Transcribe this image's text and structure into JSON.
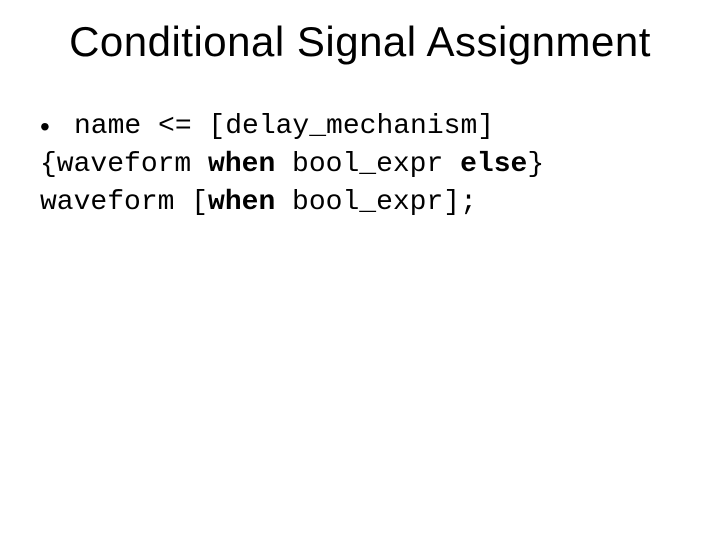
{
  "title": "Conditional Signal Assignment",
  "bullet_glyph": "•",
  "code": {
    "l1a": "name <= [delay_mechanism]",
    "l2a": "{waveform ",
    "l2b": "when",
    "l2c": " bool_expr ",
    "l2d": "else",
    "l2e": "}",
    "l3a": "waveform [",
    "l3b": "when",
    "l3c": " bool_expr];"
  }
}
